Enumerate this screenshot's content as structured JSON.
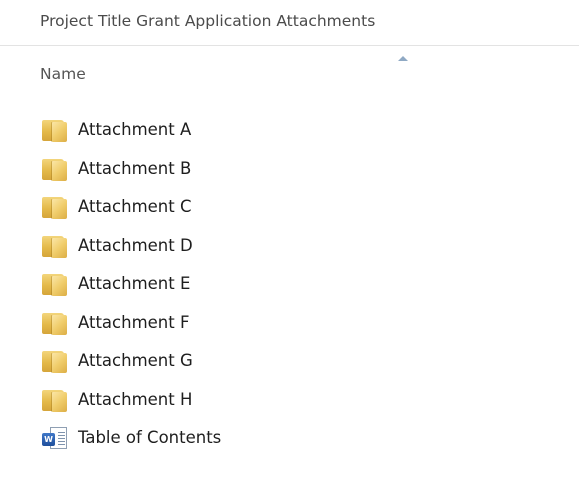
{
  "breadcrumb": {
    "path": "Project Title Grant Application Attachments"
  },
  "columns": {
    "name_label": "Name",
    "sort_direction": "ascending"
  },
  "files": [
    {
      "label": "Attachment A",
      "icon": "folder-icon"
    },
    {
      "label": "Attachment B",
      "icon": "folder-icon"
    },
    {
      "label": "Attachment C",
      "icon": "folder-icon"
    },
    {
      "label": "Attachment D",
      "icon": "folder-icon"
    },
    {
      "label": "Attachment E",
      "icon": "folder-icon"
    },
    {
      "label": "Attachment F",
      "icon": "folder-icon"
    },
    {
      "label": "Attachment G",
      "icon": "folder-icon"
    },
    {
      "label": "Attachment H",
      "icon": "folder-icon"
    },
    {
      "label": "Table of Contents",
      "icon": "word-document-icon",
      "badge": "W"
    }
  ],
  "colors": {
    "folder": "#e4b949",
    "word_badge": "#2b5fb0",
    "text": "#1e1e1e",
    "header_text": "#4b4b4b"
  }
}
